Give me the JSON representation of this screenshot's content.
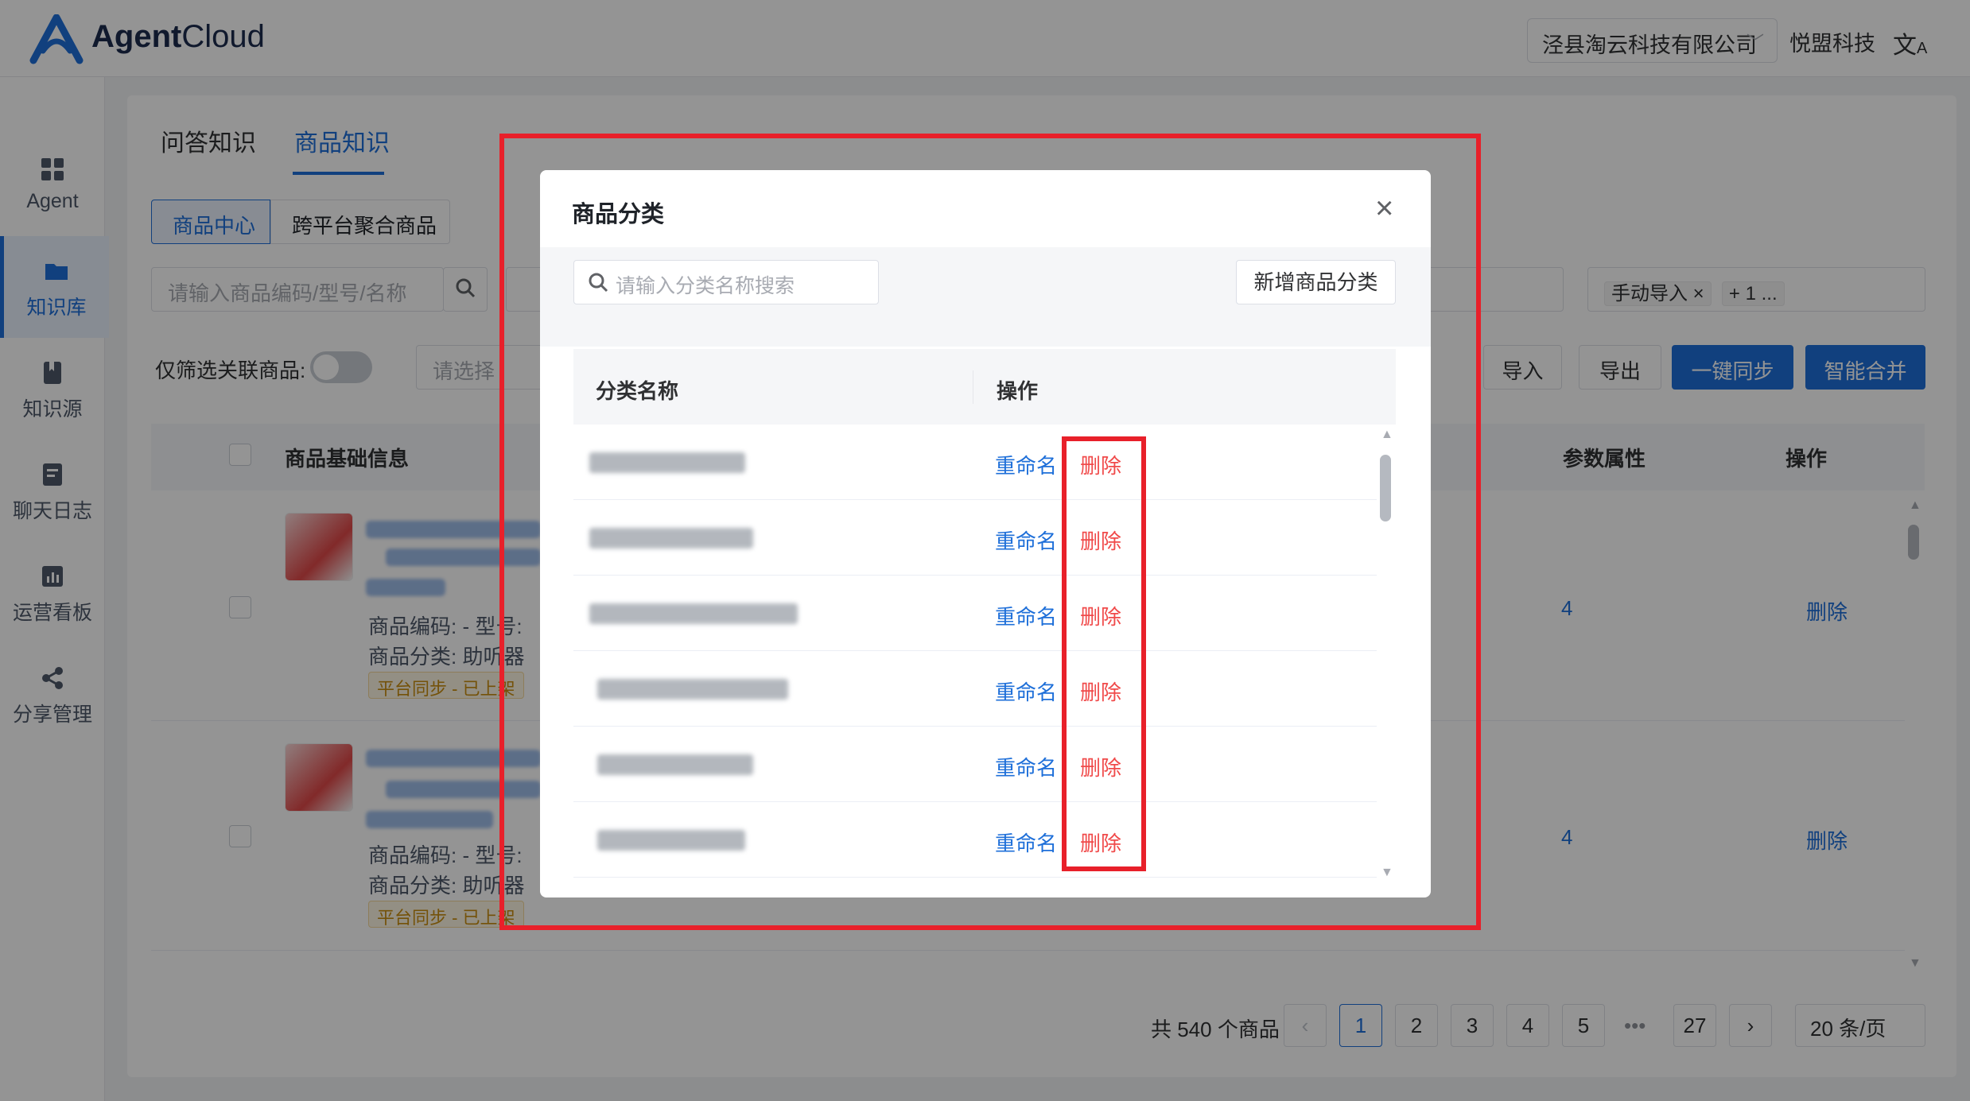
{
  "app": {
    "logo_text_bold": "Agent",
    "logo_text_light": "Cloud"
  },
  "header": {
    "company_select": "泾县淘云科技有限公司",
    "brand": "悦盟科技",
    "lang_icon": "translate-icon"
  },
  "sidebar": {
    "items": [
      {
        "label": "Agent",
        "icon": "grid-icon"
      },
      {
        "label": "知识库",
        "icon": "folder-icon"
      },
      {
        "label": "知识源",
        "icon": "book-icon"
      },
      {
        "label": "聊天日志",
        "icon": "log-icon"
      },
      {
        "label": "运营看板",
        "icon": "chart-icon"
      },
      {
        "label": "分享管理",
        "icon": "share-icon"
      }
    ]
  },
  "tabs": {
    "qa": "问答知识",
    "product": "商品知识"
  },
  "segments": {
    "center": "商品中心",
    "cross": "跨平台聚合商品"
  },
  "filters": {
    "search_placeholder": "请输入商品编码/型号/名称",
    "import_tag": "手动导入",
    "import_more": "+ 1 ...",
    "toggle_label": "仅筛选关联商品:",
    "select_placeholder": "请选择"
  },
  "buttons": {
    "import": "导入",
    "export": "导出",
    "sync": "一键同步",
    "merge": "智能合并"
  },
  "table": {
    "headers": {
      "basic": "商品基础信息",
      "params": "参数属性",
      "ops": "操作"
    },
    "rows": [
      {
        "code": "商品编码:  -    型号:",
        "category": "商品分类:  助听器",
        "tag": "平台同步 - 已上架",
        "params": "4",
        "op": "删除"
      },
      {
        "code": "商品编码:  -    型号:",
        "category": "商品分类:  助听器",
        "tag": "平台同步 - 已上架",
        "params": "4",
        "op": "删除"
      }
    ]
  },
  "pager": {
    "total": "共 540 个商品",
    "pages": [
      "1",
      "2",
      "3",
      "4",
      "5"
    ],
    "ellipsis": "•••",
    "last": "27",
    "size": "20 条/页"
  },
  "modal": {
    "title": "商品分类",
    "search_placeholder": "请输入分类名称搜索",
    "add_button": "新增商品分类",
    "col_name": "分类名称",
    "col_ops": "操作",
    "rows": [
      {
        "rename": "重命名",
        "delete": "删除"
      },
      {
        "rename": "重命名",
        "delete": "删除"
      },
      {
        "rename": "重命名",
        "delete": "删除"
      },
      {
        "rename": "重命名",
        "delete": "删除"
      },
      {
        "rename": "重命名",
        "delete": "删除"
      },
      {
        "rename": "重命名",
        "delete": "删除"
      }
    ]
  },
  "colors": {
    "accent": "#1e6fd9",
    "danger": "#f04a4a",
    "highlight": "#e8202a"
  }
}
